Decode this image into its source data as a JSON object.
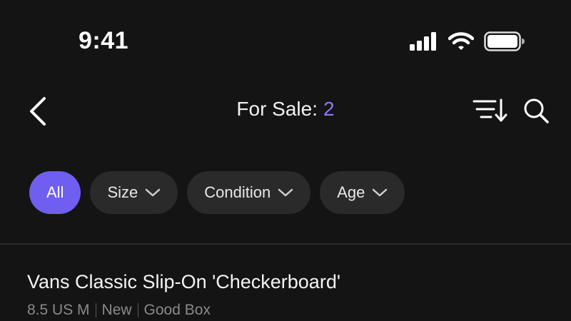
{
  "status_bar": {
    "time": "9:41",
    "icons": [
      "signal-icon",
      "wifi-icon",
      "battery-icon"
    ]
  },
  "nav": {
    "title": "For Sale:",
    "count": "2",
    "back_icon": "chevron-left-icon",
    "sort_icon": "sort-icon",
    "search_icon": "search-icon"
  },
  "filters": {
    "all_label": "All",
    "size_label": "Size",
    "condition_label": "Condition",
    "age_label": "Age",
    "active": "All"
  },
  "listings": [
    {
      "title": "Vans Classic Slip-On 'Checkerboard'",
      "size": "8.5 US M",
      "condition": "New",
      "box": "Good Box"
    }
  ],
  "colors": {
    "background": "#141414",
    "accent": "#6f5ef0",
    "count": "#8b7cf6",
    "chip": "#2a2a2a"
  }
}
